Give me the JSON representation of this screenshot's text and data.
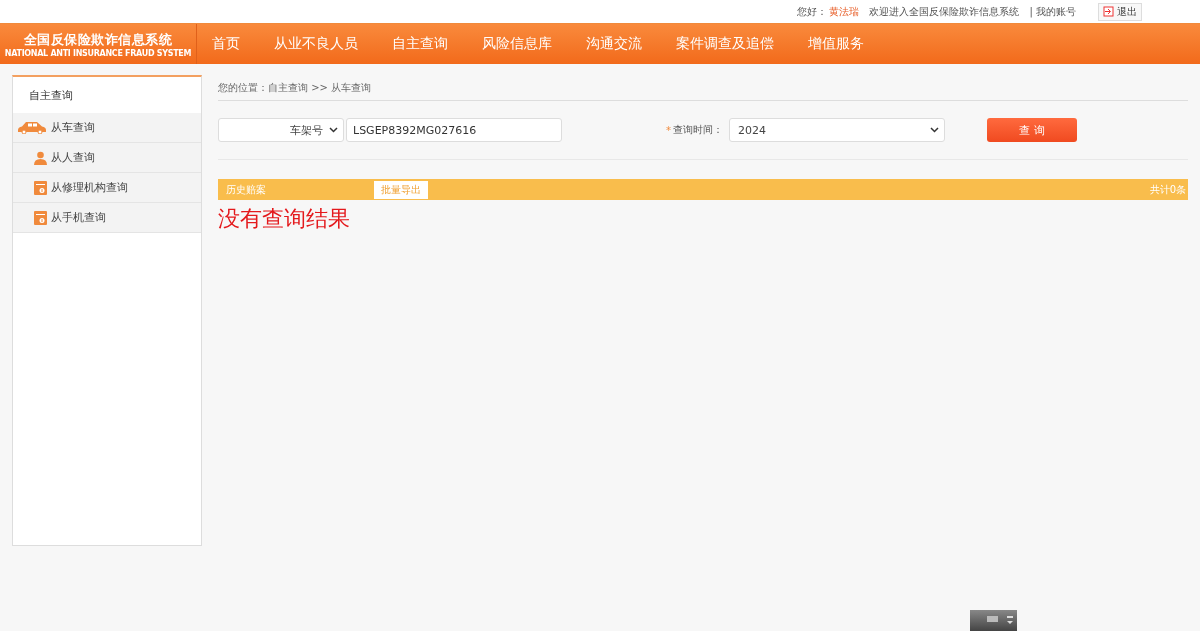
{
  "top_bar": {
    "greeting": "您好：",
    "user": "黄法瑞",
    "welcome": "欢迎进入全国反保险欺诈信息系统",
    "account": "| 我的账号",
    "logout": "退出"
  },
  "logo": {
    "title": "全国反保险欺诈信息系统",
    "subtitle": "NATIONAL ANTI INSURANCE FRAUD SYSTEM"
  },
  "nav": [
    {
      "label": "首页"
    },
    {
      "label": "从业不良人员"
    },
    {
      "label": "自主查询"
    },
    {
      "label": "风险信息库"
    },
    {
      "label": "沟通交流"
    },
    {
      "label": "案件调查及追偿"
    },
    {
      "label": "增值服务"
    }
  ],
  "sidebar": {
    "title": "自主查询",
    "items": [
      {
        "label": "从车查询",
        "kind": "car"
      },
      {
        "label": "从人查询",
        "kind": "person"
      },
      {
        "label": "从修理机构查询",
        "kind": "box"
      },
      {
        "label": "从手机查询",
        "kind": "box"
      }
    ]
  },
  "breadcrumb": "您的位置：自主查询 >> 从车查询",
  "search": {
    "type_select": "车架号",
    "vin_value": "LSGEP8392MG027616",
    "required_mark": "*",
    "time_label": "查询时间：",
    "time_select": "2024",
    "button": "查 询"
  },
  "results": {
    "title": "历史赔案",
    "export": "批量导出",
    "count": "共计0条",
    "empty": "没有查询结果"
  }
}
